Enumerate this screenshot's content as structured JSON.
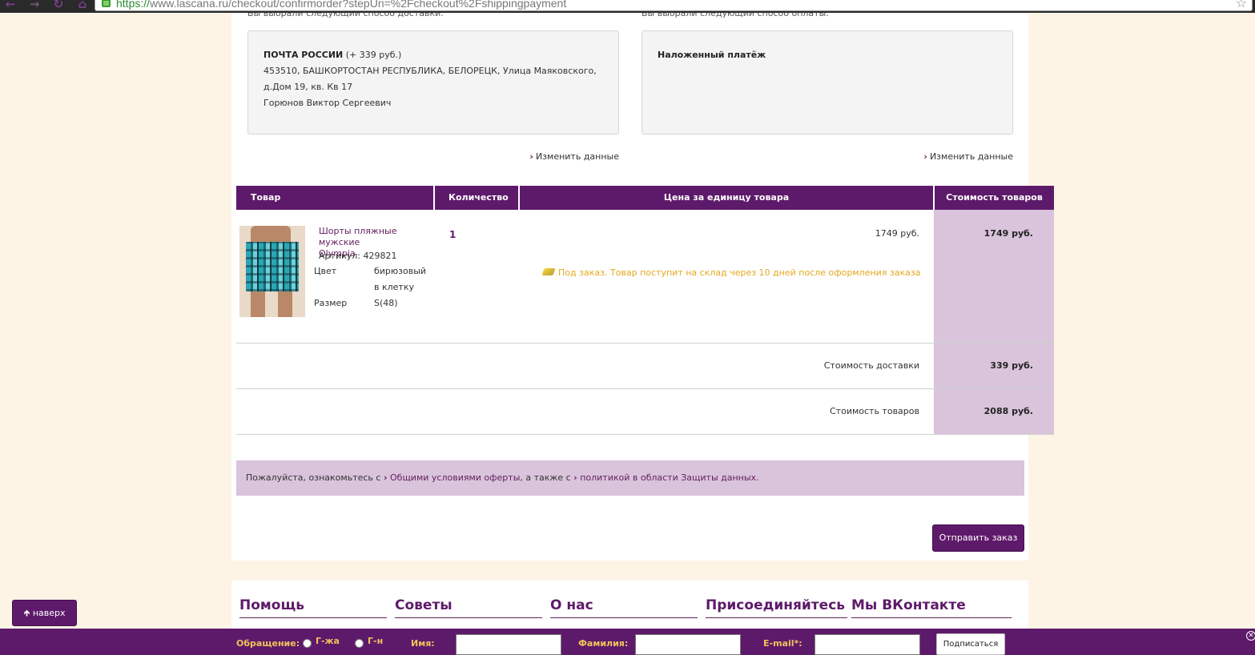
{
  "browser": {
    "url_scheme": "https://",
    "url_rest": "www.lascana.ru/checkout/confirmorder?stepUri=%2Fcheckout%2Fshippingpayment",
    "back_icon": "back-arrow-icon",
    "forward_icon": "forward-arrow-icon",
    "reload_icon": "reload-icon",
    "home_icon": "home-icon"
  },
  "shipping": {
    "heading": "Вы выбрали следующий способ доставки:",
    "method": "ПОЧТА РОССИИ",
    "method_price": "(+ 339 руб.)",
    "address_line1": "453510, БАШКОРТОСТАН РЕСПУБЛИКА, БЕЛОРЕЦК, Улица Маяковского,",
    "address_line2": "д.Дом 19, кв. Кв 17",
    "recipient": "Горюнов Виктор Сергеевич",
    "change_label": "Изменить данные"
  },
  "payment": {
    "heading": "Вы выбрали следующий способ оплаты:",
    "method": "Наложенный платёж",
    "change_label": "Изменить данные"
  },
  "table": {
    "headers": [
      "Товар",
      "Количество",
      "Цена за единицу товара",
      "Стоимость товаров"
    ],
    "item": {
      "name": "Шорты пляжные мужские Olympia",
      "sku": "Артикул: 429821",
      "color_label": "Цвет",
      "color_value": "бирюзовый в клетку",
      "size_label": "Размер",
      "size_value": "S(48)",
      "qty": "1",
      "unit_price": "1749 руб.",
      "cost": "1749 руб.",
      "notice": "Под заказ. Товар поступит на склад через 10 дней после оформления заказа"
    },
    "delivery_label": "Стоимость доставки",
    "delivery_cost": "339 руб.",
    "total_label": "Стоимость товаров",
    "total_cost": "2088 руб."
  },
  "terms": {
    "prefix": "Пожалуйста, ознакомьтесь с",
    "link1": "Общими условиями оферты",
    "middle": ", а также с",
    "link2": "политикой в области Защиты данных",
    "suffix": "."
  },
  "submit_label": "Отправить заказ",
  "footer": {
    "columns": [
      "Помощь",
      "Советы",
      "О нас",
      "Присоединяйтесь",
      "Мы ВКонтакте"
    ]
  },
  "top_button": "наверх",
  "newsletter": {
    "greeting_label": "Обращение:",
    "option_female": "Г-жа",
    "option_male": "Г-н",
    "name_label": "Имя:",
    "surname_label": "Фамилия:",
    "email_label": "E-mail*:",
    "subscribe_label": "Подписаться"
  },
  "colors": {
    "brand_purple": "#5e1a6a",
    "cost_column": "#d9c4dc",
    "notice_yellow": "#e4a81e",
    "page_bg": "#fdf4e6"
  }
}
